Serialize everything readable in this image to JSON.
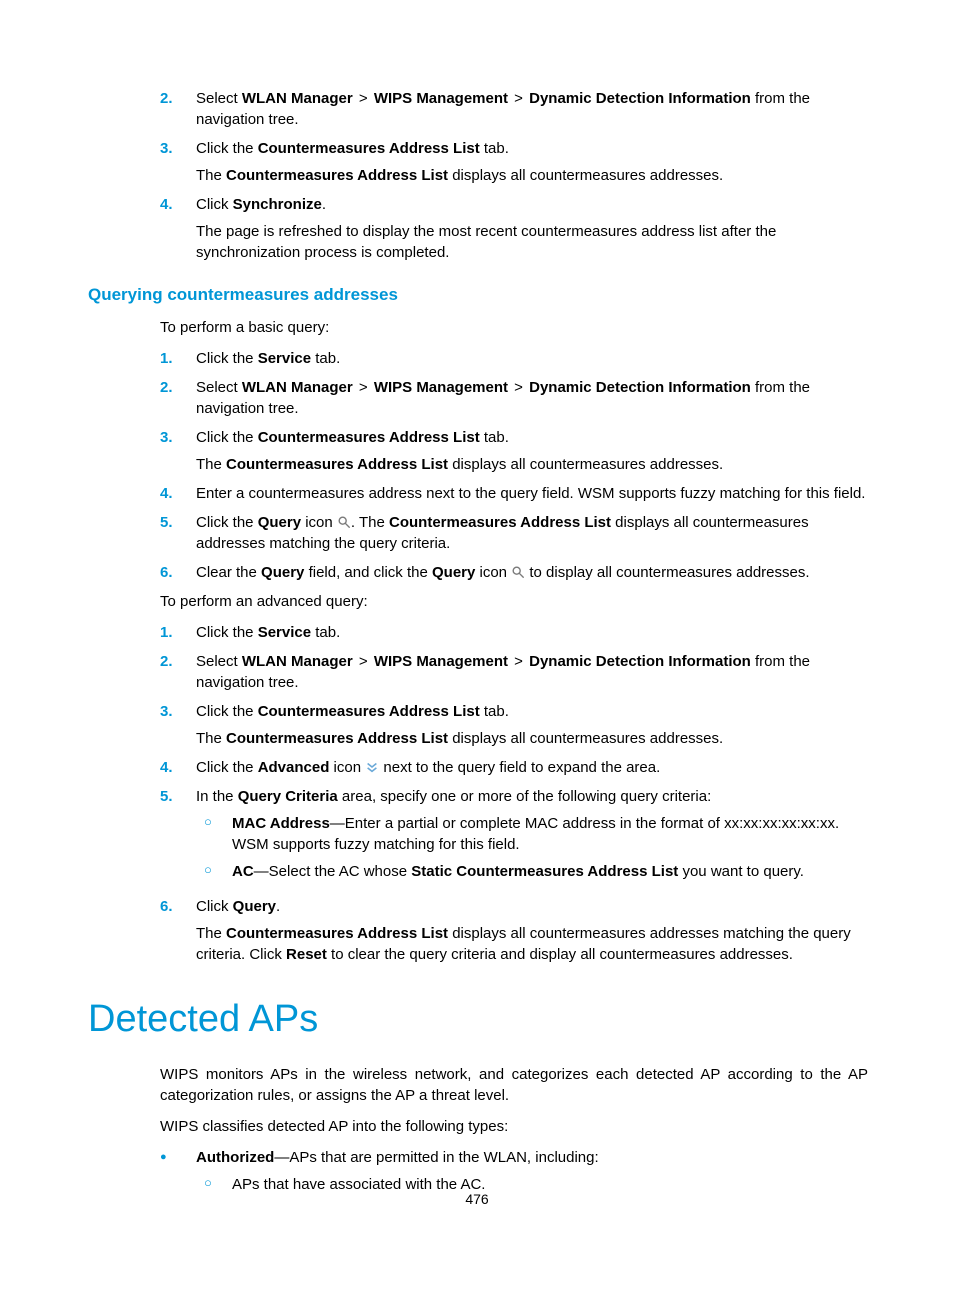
{
  "steps_top": {
    "n2": "2.",
    "n3": "3.",
    "n4": "4.",
    "s2a": "Select ",
    "s2b_wlan": "WLAN Manager",
    "s2c_gt": " > ",
    "s2d_wips": "WIPS Management",
    "s2e_gt": " > ",
    "s2f_ddi": "Dynamic Detection Information",
    "s2g": " from the navigation tree.",
    "s3a": "Click the ",
    "s3b": "Countermeasures Address List",
    "s3c": " tab.",
    "s3d": "The ",
    "s3e": "Countermeasures Address List",
    "s3f": " displays all countermeasures addresses.",
    "s4a": "Click ",
    "s4b": "Synchronize",
    "s4c": ".",
    "s4d": "The page is refreshed to display the most recent countermeasures address list after the synchronization process is completed."
  },
  "section_query_heading": "Querying countermeasures addresses",
  "basic_intro": "To perform a basic query:",
  "basic": {
    "n1": "1.",
    "n2": "2.",
    "n3": "3.",
    "n4": "4.",
    "n5": "5.",
    "n6": "6.",
    "s1a": "Click the ",
    "s1b": "Service",
    "s1c": " tab.",
    "s2a": "Select ",
    "s2b": "WLAN Manager",
    "s2c": " > ",
    "s2d": "WIPS Management",
    "s2e": " > ",
    "s2f": "Dynamic Detection Information",
    "s2g": " from the navigation tree.",
    "s3a": "Click the ",
    "s3b": "Countermeasures Address List",
    "s3c": " tab.",
    "s3d": "The ",
    "s3e": "Countermeasures Address List",
    "s3f": " displays all countermeasures addresses.",
    "s4": "Enter a countermeasures address next to the query field. WSM supports fuzzy matching for this field.",
    "s5a": "Click the ",
    "s5b": "Query",
    "s5c": " icon ",
    "s5d": ". The ",
    "s5e": "Countermeasures Address List",
    "s5f": " displays all countermeasures addresses matching the query criteria.",
    "s6a": "Clear the ",
    "s6b": "Query",
    "s6c": " field, and click the ",
    "s6d": "Query",
    "s6e": " icon ",
    "s6f": " to display all countermeasures addresses."
  },
  "adv_intro": "To perform an advanced query:",
  "adv": {
    "n1": "1.",
    "n2": "2.",
    "n3": "3.",
    "n4": "4.",
    "n5": "5.",
    "n6": "6.",
    "s1a": "Click the ",
    "s1b": "Service",
    "s1c": " tab.",
    "s2a": "Select ",
    "s2b": "WLAN Manager",
    "s2c": " > ",
    "s2d": "WIPS Management",
    "s2e": " > ",
    "s2f": "Dynamic Detection Information",
    "s2g": " from the navigation tree.",
    "s3a": "Click the ",
    "s3b": "Countermeasures Address List",
    "s3c": " tab.",
    "s3d": "The ",
    "s3e": "Countermeasures Address List",
    "s3f": " displays all countermeasures addresses.",
    "s4a": "Click the ",
    "s4b": "Advanced",
    "s4c": " icon ",
    "s4d": " next to the query field to expand the area.",
    "s5a": "In the ",
    "s5b": "Query Criteria",
    "s5c": " area, specify one or more of the following query criteria:",
    "s5_sub1a": "MAC Address",
    "s5_sub1b": "—Enter a partial or complete MAC address in the format of xx:xx:xx:xx:xx:xx. WSM supports fuzzy matching for this field.",
    "s5_sub2a": "AC",
    "s5_sub2b": "—Select the AC whose ",
    "s5_sub2c": "Static Countermeasures Address List",
    "s5_sub2d": " you want to query.",
    "s6a": "Click ",
    "s6b": "Query",
    "s6c": ".",
    "s6d": "The ",
    "s6e": "Countermeasures Address List",
    "s6f": " displays all countermeasures addresses matching the query criteria. Click ",
    "s6g": "Reset",
    "s6h": " to clear the query criteria and display all countermeasures addresses."
  },
  "detected_heading": "Detected APs",
  "detected_p1": "WIPS monitors APs in the wireless network, and categorizes each detected AP according to the AP categorization rules, or assigns the AP a threat level.",
  "detected_p2": "WIPS classifies detected AP into the following types:",
  "detected_bullet": {
    "b1a": "Authorized",
    "b1b": "—APs that are permitted in the WLAN, including:",
    "sub1": "APs that have associated with the AC."
  },
  "circ": "○",
  "page_number": "476"
}
